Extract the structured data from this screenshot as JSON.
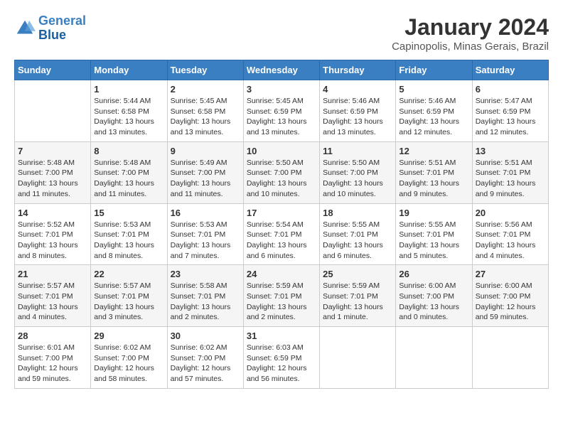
{
  "header": {
    "logo_line1": "General",
    "logo_line2": "Blue",
    "title": "January 2024",
    "subtitle": "Capinopolis, Minas Gerais, Brazil"
  },
  "columns": [
    "Sunday",
    "Monday",
    "Tuesday",
    "Wednesday",
    "Thursday",
    "Friday",
    "Saturday"
  ],
  "weeks": [
    [
      {
        "day": "",
        "info": ""
      },
      {
        "day": "1",
        "info": "Sunrise: 5:44 AM\nSunset: 6:58 PM\nDaylight: 13 hours\nand 13 minutes."
      },
      {
        "day": "2",
        "info": "Sunrise: 5:45 AM\nSunset: 6:58 PM\nDaylight: 13 hours\nand 13 minutes."
      },
      {
        "day": "3",
        "info": "Sunrise: 5:45 AM\nSunset: 6:59 PM\nDaylight: 13 hours\nand 13 minutes."
      },
      {
        "day": "4",
        "info": "Sunrise: 5:46 AM\nSunset: 6:59 PM\nDaylight: 13 hours\nand 13 minutes."
      },
      {
        "day": "5",
        "info": "Sunrise: 5:46 AM\nSunset: 6:59 PM\nDaylight: 13 hours\nand 12 minutes."
      },
      {
        "day": "6",
        "info": "Sunrise: 5:47 AM\nSunset: 6:59 PM\nDaylight: 13 hours\nand 12 minutes."
      }
    ],
    [
      {
        "day": "7",
        "info": "Sunrise: 5:48 AM\nSunset: 7:00 PM\nDaylight: 13 hours\nand 11 minutes."
      },
      {
        "day": "8",
        "info": "Sunrise: 5:48 AM\nSunset: 7:00 PM\nDaylight: 13 hours\nand 11 minutes."
      },
      {
        "day": "9",
        "info": "Sunrise: 5:49 AM\nSunset: 7:00 PM\nDaylight: 13 hours\nand 11 minutes."
      },
      {
        "day": "10",
        "info": "Sunrise: 5:50 AM\nSunset: 7:00 PM\nDaylight: 13 hours\nand 10 minutes."
      },
      {
        "day": "11",
        "info": "Sunrise: 5:50 AM\nSunset: 7:00 PM\nDaylight: 13 hours\nand 10 minutes."
      },
      {
        "day": "12",
        "info": "Sunrise: 5:51 AM\nSunset: 7:01 PM\nDaylight: 13 hours\nand 9 minutes."
      },
      {
        "day": "13",
        "info": "Sunrise: 5:51 AM\nSunset: 7:01 PM\nDaylight: 13 hours\nand 9 minutes."
      }
    ],
    [
      {
        "day": "14",
        "info": "Sunrise: 5:52 AM\nSunset: 7:01 PM\nDaylight: 13 hours\nand 8 minutes."
      },
      {
        "day": "15",
        "info": "Sunrise: 5:53 AM\nSunset: 7:01 PM\nDaylight: 13 hours\nand 8 minutes."
      },
      {
        "day": "16",
        "info": "Sunrise: 5:53 AM\nSunset: 7:01 PM\nDaylight: 13 hours\nand 7 minutes."
      },
      {
        "day": "17",
        "info": "Sunrise: 5:54 AM\nSunset: 7:01 PM\nDaylight: 13 hours\nand 6 minutes."
      },
      {
        "day": "18",
        "info": "Sunrise: 5:55 AM\nSunset: 7:01 PM\nDaylight: 13 hours\nand 6 minutes."
      },
      {
        "day": "19",
        "info": "Sunrise: 5:55 AM\nSunset: 7:01 PM\nDaylight: 13 hours\nand 5 minutes."
      },
      {
        "day": "20",
        "info": "Sunrise: 5:56 AM\nSunset: 7:01 PM\nDaylight: 13 hours\nand 4 minutes."
      }
    ],
    [
      {
        "day": "21",
        "info": "Sunrise: 5:57 AM\nSunset: 7:01 PM\nDaylight: 13 hours\nand 4 minutes."
      },
      {
        "day": "22",
        "info": "Sunrise: 5:57 AM\nSunset: 7:01 PM\nDaylight: 13 hours\nand 3 minutes."
      },
      {
        "day": "23",
        "info": "Sunrise: 5:58 AM\nSunset: 7:01 PM\nDaylight: 13 hours\nand 2 minutes."
      },
      {
        "day": "24",
        "info": "Sunrise: 5:59 AM\nSunset: 7:01 PM\nDaylight: 13 hours\nand 2 minutes."
      },
      {
        "day": "25",
        "info": "Sunrise: 5:59 AM\nSunset: 7:01 PM\nDaylight: 13 hours\nand 1 minute."
      },
      {
        "day": "26",
        "info": "Sunrise: 6:00 AM\nSunset: 7:00 PM\nDaylight: 13 hours\nand 0 minutes."
      },
      {
        "day": "27",
        "info": "Sunrise: 6:00 AM\nSunset: 7:00 PM\nDaylight: 12 hours\nand 59 minutes."
      }
    ],
    [
      {
        "day": "28",
        "info": "Sunrise: 6:01 AM\nSunset: 7:00 PM\nDaylight: 12 hours\nand 59 minutes."
      },
      {
        "day": "29",
        "info": "Sunrise: 6:02 AM\nSunset: 7:00 PM\nDaylight: 12 hours\nand 58 minutes."
      },
      {
        "day": "30",
        "info": "Sunrise: 6:02 AM\nSunset: 7:00 PM\nDaylight: 12 hours\nand 57 minutes."
      },
      {
        "day": "31",
        "info": "Sunrise: 6:03 AM\nSunset: 6:59 PM\nDaylight: 12 hours\nand 56 minutes."
      },
      {
        "day": "",
        "info": ""
      },
      {
        "day": "",
        "info": ""
      },
      {
        "day": "",
        "info": ""
      }
    ]
  ]
}
